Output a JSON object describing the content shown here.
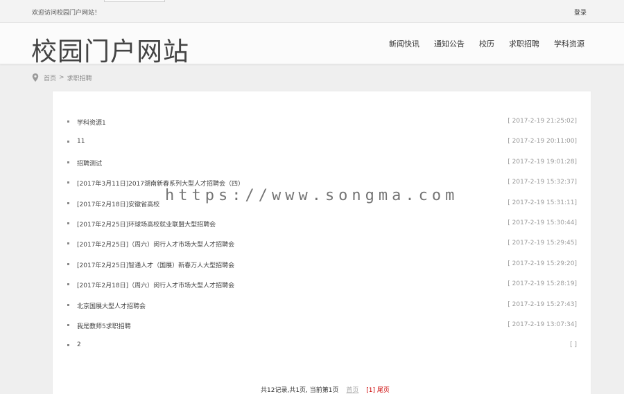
{
  "topbar": {
    "welcome": "欢迎访问校园门户网站！",
    "login": "登录"
  },
  "header": {
    "logo": "校园门户网站",
    "nav": [
      "新闻快讯",
      "通知公告",
      "校历",
      "求职招聘",
      "学科资源"
    ]
  },
  "breadcrumb": {
    "home": "首页",
    "separator": ">",
    "current": "求职招聘"
  },
  "list": [
    {
      "title": "学科资源1",
      "date": "[ 2017-2-19 21:25:02]"
    },
    {
      "title": "11",
      "date": "[ 2017-2-19 20:11:00]"
    },
    {
      "title": "招聘测试",
      "date": "[ 2017-2-19 19:01:28]"
    },
    {
      "title": "[2017年3月11日]2017湖南新春系列大型人才招聘会（四）",
      "date": "[ 2017-2-19 15:32:37]"
    },
    {
      "title": "[2017年2月18日]安徽省高校",
      "date": "[ 2017-2-19 15:31:11]"
    },
    {
      "title": "[2017年2月25日]环球场高校就业联盟大型招聘会",
      "date": "[ 2017-2-19 15:30:44]"
    },
    {
      "title": "[2017年2月25日]（周六）闵行人才市场大型人才招聘会",
      "date": "[ 2017-2-19 15:29:45]"
    },
    {
      "title": "[2017年2月25日]智通人才（国展）新春万人大型招聘会",
      "date": "[ 2017-2-19 15:29:20]"
    },
    {
      "title": "[2017年2月18日]（周六）闵行人才市场大型人才招聘会",
      "date": "[ 2017-2-19 15:28:19]"
    },
    {
      "title": "北京国展大型人才招聘会",
      "date": "[ 2017-2-19 15:27:43]"
    },
    {
      "title": "我是教师5求职招聘",
      "date": "[ 2017-2-19 13:07:34]"
    },
    {
      "title": "2",
      "date": "[ ]"
    }
  ],
  "pager": {
    "summary": "共12记录,共1页, 当前第1页",
    "first": "首页",
    "last": "[1] 尾页"
  },
  "watermark": "https://www.songma.com",
  "colors": {
    "accent_red": "#cc0000",
    "background": "#efefef"
  },
  "icons": {
    "breadcrumb": "map-pin-icon"
  }
}
